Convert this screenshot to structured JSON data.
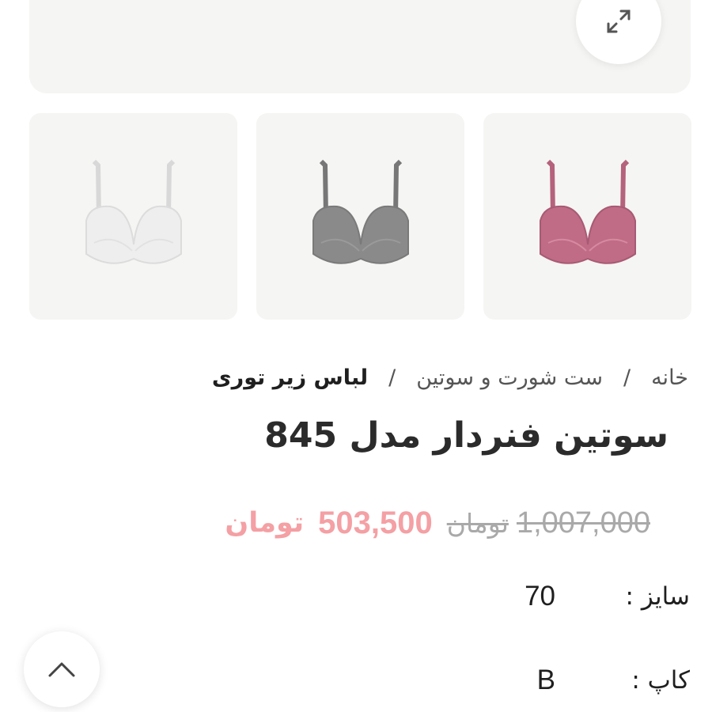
{
  "gallery": {
    "expand_icon": "expand-arrows-icon",
    "thumbnails": [
      {
        "name": "white bra",
        "color": "#eeeeee",
        "strap": "#d8d8d8"
      },
      {
        "name": "gray bra",
        "color": "#8a8a8a",
        "strap": "#777777"
      },
      {
        "name": "pink bra",
        "color": "#c06c86",
        "strap": "#b5627c"
      }
    ]
  },
  "breadcrumb": {
    "home": "خانه",
    "category": "ست شورت و سوتین",
    "current": "لباس زیر توری",
    "separator": "/"
  },
  "product": {
    "title": "سوتین فنردار مدل 845",
    "old_price": "1,007,000",
    "old_currency": "تومان",
    "new_price": "503,500",
    "new_currency": "تومان",
    "size_label": "سایز :",
    "size_value": "70",
    "cup_label": "کاپ :",
    "cup_value": "B"
  },
  "colors": {
    "price_accent": "#f4a0a4",
    "panel_bg": "#f5f5f3"
  },
  "scroll_top_icon": "chevron-up-icon"
}
